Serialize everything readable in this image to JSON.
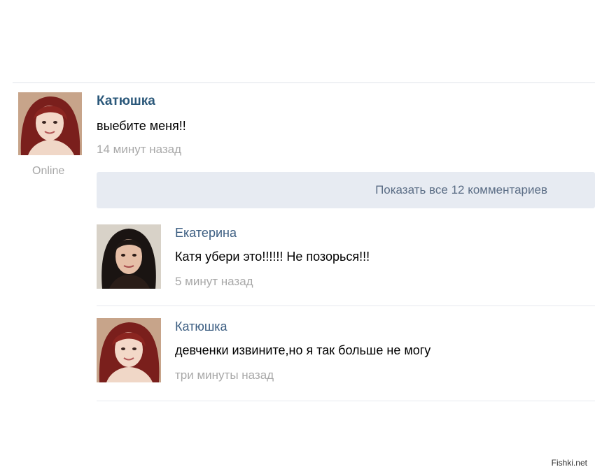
{
  "post": {
    "author": "Катюшка",
    "text": "выебите меня!!",
    "time": "14 минут назад",
    "status": "Online",
    "avatar_icon": "woman-red-hair-avatar"
  },
  "show_all_comments": {
    "label": "Показать все 12 комментариев"
  },
  "comments": [
    {
      "author": "Екатерина",
      "text": "Катя убери это!!!!!! Не позорься!!!",
      "time": "5 минут назад",
      "avatar_icon": "woman-dark-hair-avatar"
    },
    {
      "author": "Катюшка",
      "text": "девченки извините,но я так больше не могу",
      "time": "три минуты назад",
      "avatar_icon": "woman-red-hair-avatar"
    }
  ],
  "watermark": "Fishki.net",
  "colors": {
    "author_link": "#2b587a",
    "secondary_text": "#a8a8a8",
    "show_all_bg": "#e7ebf2"
  }
}
